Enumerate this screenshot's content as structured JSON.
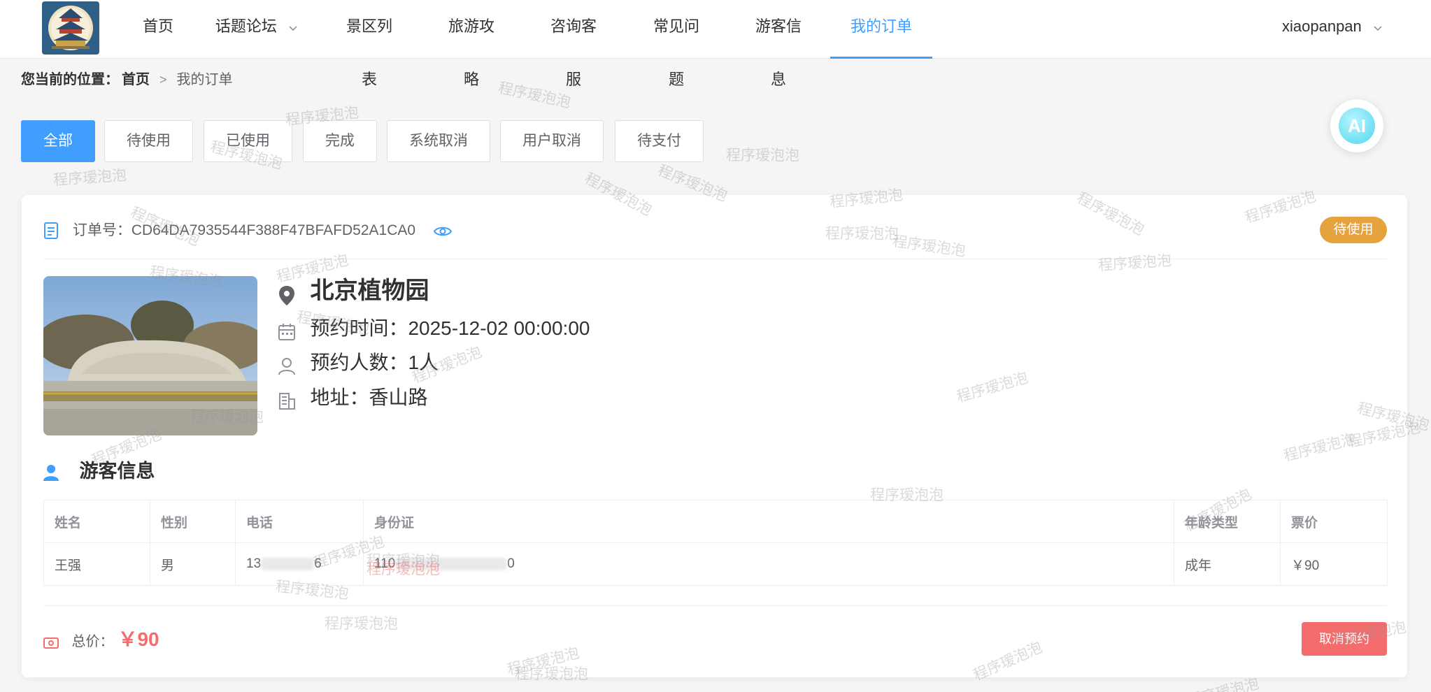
{
  "nav": {
    "items": [
      {
        "label": "首页",
        "active": false,
        "dropdown": false
      },
      {
        "label": "话题论坛",
        "active": false,
        "dropdown": true
      },
      {
        "label": "景区列表",
        "active": false,
        "dropdown": false
      },
      {
        "label": "旅游攻略",
        "active": false,
        "dropdown": false
      },
      {
        "label": "咨询客服",
        "active": false,
        "dropdown": false
      },
      {
        "label": "常见问题",
        "active": false,
        "dropdown": false
      },
      {
        "label": "游客信息",
        "active": false,
        "dropdown": false
      },
      {
        "label": "我的订单",
        "active": true,
        "dropdown": false
      }
    ],
    "user": "xiaopanpan",
    "accent_color": "#409eff"
  },
  "breadcrumb": {
    "prefix": "您当前的位置：",
    "home": "首页",
    "current": "我的订单"
  },
  "tabs": [
    "全部",
    "待使用",
    "已使用",
    "完成",
    "系统取消",
    "用户取消",
    "待支付"
  ],
  "active_tab": "全部",
  "ai_button": {
    "label": "AI"
  },
  "order": {
    "number_label": "订单号：",
    "number": "CD64DA7935544F388F47BFAFD52A1CA0",
    "status": "待使用",
    "status_color": "#e6a23c",
    "spot_name": "北京植物园",
    "booking_time_label": "预约时间：",
    "booking_time": "2025-12-02 00:00:00",
    "people_label": "预约人数：",
    "people": "1人",
    "address_label": "地址：",
    "address": "香山路",
    "visitor_section_title": "游客信息",
    "table": {
      "headers": [
        "姓名",
        "性别",
        "电话",
        "身份证",
        "年龄类型",
        "票价"
      ],
      "rows": [
        {
          "name": "王强",
          "gender": "男",
          "phone_start": "13",
          "phone_end": "6",
          "id_start": "110",
          "id_end": "0",
          "age_type": "成年",
          "price": "￥90"
        }
      ]
    },
    "total_label": "总价：",
    "total": "￥90",
    "cancel_label": "取消预约",
    "cancel_color": "#f56c6c"
  },
  "watermark": "程序瑷泡泡"
}
